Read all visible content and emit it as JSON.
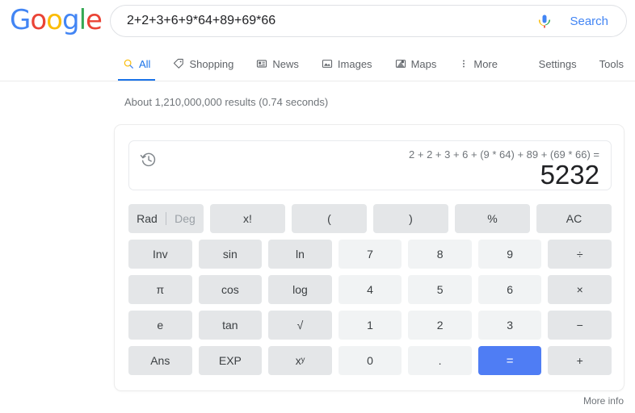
{
  "header": {
    "logo_letters": [
      "G",
      "o",
      "o",
      "g",
      "l",
      "e"
    ],
    "search_value": "2+2+3+6+9*64+89+69*66",
    "search_placeholder": "Search",
    "search_button_label": "Search",
    "mic_icon": "microphone-icon"
  },
  "nav": {
    "tabs": [
      {
        "label": "All",
        "icon": "search-icon",
        "active": true
      },
      {
        "label": "Shopping",
        "icon": "tag-icon",
        "active": false
      },
      {
        "label": "News",
        "icon": "newspaper-icon",
        "active": false
      },
      {
        "label": "Images",
        "icon": "image-icon",
        "active": false
      },
      {
        "label": "Maps",
        "icon": "map-pin-icon",
        "active": false
      },
      {
        "label": "More",
        "icon": "more-vertical-icon",
        "active": false
      }
    ],
    "settings_label": "Settings",
    "tools_label": "Tools"
  },
  "result_stats": "About 1,210,000,000 results (0.74 seconds)",
  "calculator": {
    "history_icon": "history-clock-icon",
    "expression": "2 + 2 + 3 + 6 + (9 * 64) + 89 + (69 * 66) =",
    "answer": "5232",
    "mode": {
      "rad_label": "Rad",
      "deg_label": "Deg",
      "active": "Rad"
    },
    "rows": [
      [
        {
          "label": "",
          "kind": "radeg",
          "name": "rad-deg-toggle"
        },
        {
          "label": "x!",
          "kind": "fn",
          "name": "factorial-key"
        },
        {
          "label": "(",
          "kind": "fn",
          "name": "open-paren-key"
        },
        {
          "label": ")",
          "kind": "fn",
          "name": "close-paren-key"
        },
        {
          "label": "%",
          "kind": "fn",
          "name": "percent-key"
        },
        {
          "label": "AC",
          "kind": "fn",
          "name": "all-clear-key"
        }
      ],
      [
        {
          "label": "Inv",
          "kind": "fn",
          "name": "inverse-key"
        },
        {
          "label": "sin",
          "kind": "fn",
          "name": "sin-key"
        },
        {
          "label": "ln",
          "kind": "fn",
          "name": "ln-key"
        },
        {
          "label": "7",
          "kind": "num",
          "name": "digit-7-key"
        },
        {
          "label": "8",
          "kind": "num",
          "name": "digit-8-key"
        },
        {
          "label": "9",
          "kind": "num",
          "name": "digit-9-key"
        },
        {
          "label": "÷",
          "kind": "op",
          "name": "divide-key"
        }
      ],
      [
        {
          "label": "π",
          "kind": "fn",
          "name": "pi-key"
        },
        {
          "label": "cos",
          "kind": "fn",
          "name": "cos-key"
        },
        {
          "label": "log",
          "kind": "fn",
          "name": "log-key"
        },
        {
          "label": "4",
          "kind": "num",
          "name": "digit-4-key"
        },
        {
          "label": "5",
          "kind": "num",
          "name": "digit-5-key"
        },
        {
          "label": "6",
          "kind": "num",
          "name": "digit-6-key"
        },
        {
          "label": "×",
          "kind": "op",
          "name": "multiply-key"
        }
      ],
      [
        {
          "label": "e",
          "kind": "fn",
          "name": "euler-key"
        },
        {
          "label": "tan",
          "kind": "fn",
          "name": "tan-key"
        },
        {
          "label": "√",
          "kind": "fn",
          "name": "square-root-key"
        },
        {
          "label": "1",
          "kind": "num",
          "name": "digit-1-key"
        },
        {
          "label": "2",
          "kind": "num",
          "name": "digit-2-key"
        },
        {
          "label": "3",
          "kind": "num",
          "name": "digit-3-key"
        },
        {
          "label": "−",
          "kind": "op",
          "name": "minus-key"
        }
      ],
      [
        {
          "label": "Ans",
          "kind": "fn",
          "name": "answer-key"
        },
        {
          "label": "EXP",
          "kind": "fn",
          "name": "exponent-key"
        },
        {
          "label": "xʸ",
          "kind": "fn",
          "name": "power-key"
        },
        {
          "label": "0",
          "kind": "num",
          "name": "digit-0-key"
        },
        {
          "label": ".",
          "kind": "num",
          "name": "decimal-point-key"
        },
        {
          "label": "=",
          "kind": "eq",
          "name": "equals-key"
        },
        {
          "label": "+",
          "kind": "op",
          "name": "plus-key"
        }
      ]
    ]
  },
  "footer": {
    "more_info_label": "More info"
  },
  "colors": {
    "google_blue": "#4285f4",
    "google_red": "#ea4335",
    "google_yellow": "#fbbc05",
    "google_green": "#34a853",
    "link_blue": "#1a73e8",
    "equals_blue": "#4f7df4",
    "function_key_bg": "#e4e6e8",
    "number_key_bg": "#f1f3f4",
    "text_gray": "#70757a"
  }
}
